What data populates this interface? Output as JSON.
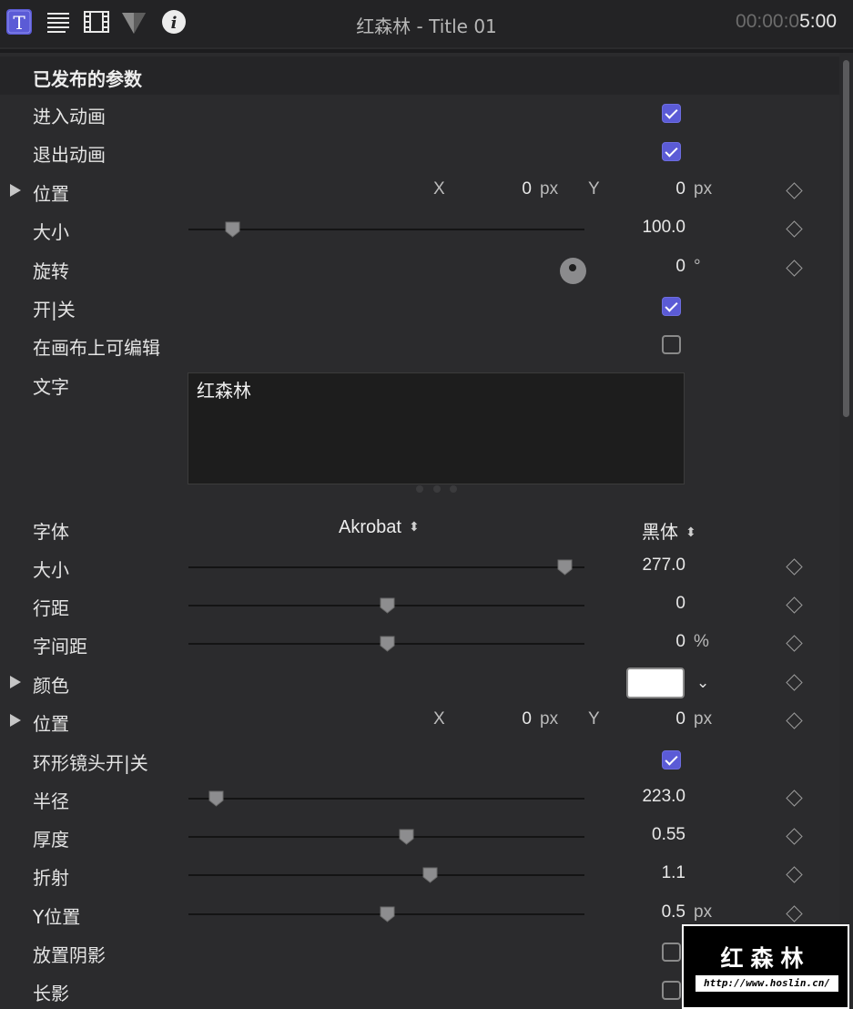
{
  "toolbar": {
    "icons": [
      "text-inspector-icon",
      "paragraph-icon",
      "film-icon",
      "color-inspector-icon",
      "info-icon"
    ],
    "title": "红森林 - Title 01",
    "timecode_dim": "00:00:0",
    "timecode_bright": "5:00"
  },
  "section": {
    "title": "已发布的参数"
  },
  "params": {
    "build_in": {
      "label": "进入动画",
      "checked": true
    },
    "build_out": {
      "label": "退出动画",
      "checked": true
    },
    "position": {
      "label": "位置",
      "x_label": "X",
      "x": "0",
      "x_unit": "px",
      "y_label": "Y",
      "y": "0",
      "y_unit": "px"
    },
    "size": {
      "label": "大小",
      "value": "100.0",
      "slider": 0.11
    },
    "rotation": {
      "label": "旋转",
      "value": "0",
      "unit": "°"
    },
    "onoff": {
      "label": "开|关",
      "checked": true
    },
    "editable": {
      "label": "在画布上可编辑",
      "checked": false
    },
    "text": {
      "label": "文字",
      "value": "红森林"
    },
    "font": {
      "label": "字体",
      "family": "Akrobat",
      "typeface": "黑体"
    },
    "font_size": {
      "label": "大小",
      "value": "277.0",
      "slider": 0.95
    },
    "line_spacing": {
      "label": "行距",
      "value": "0",
      "slider": 0.5
    },
    "tracking": {
      "label": "字间距",
      "value": "0",
      "unit": "%",
      "slider": 0.5
    },
    "color": {
      "label": "颜色",
      "swatch": "#ffffff"
    },
    "position2": {
      "label": "位置",
      "x_label": "X",
      "x": "0",
      "x_unit": "px",
      "y_label": "Y",
      "y": "0",
      "y_unit": "px"
    },
    "lens_onoff": {
      "label": "环形镜头开|关",
      "checked": true
    },
    "radius": {
      "label": "半径",
      "value": "223.0",
      "slider": 0.07
    },
    "thickness": {
      "label": "厚度",
      "value": "0.55",
      "slider": 0.55
    },
    "refraction": {
      "label": "折射",
      "value": "1.1",
      "slider": 0.61
    },
    "y_position": {
      "label": "Y位置",
      "value": "0.5",
      "unit": "px",
      "slider": 0.5
    },
    "drop_shadow": {
      "label": "放置阴影",
      "checked": false
    },
    "long_shadow": {
      "label": "长影",
      "checked": false
    }
  },
  "watermark": {
    "title": "红森林",
    "url": "http://www.hoslin.cn/"
  },
  "colors": {
    "accent": "#5b5bd6",
    "panel": "#2b2b2d",
    "toolbar": "#232325"
  }
}
